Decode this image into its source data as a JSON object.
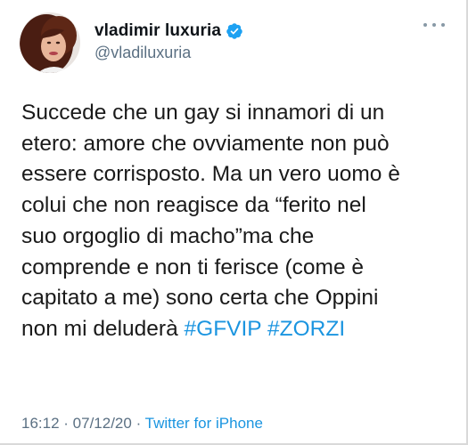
{
  "author": {
    "display_name": "vladimir luxuria",
    "handle": "@vladiluxuria",
    "verified": true,
    "avatar_icon": "profile-photo"
  },
  "tweet": {
    "text": "Succede che un gay si innamori di un\netero: amore che ovviamente non può\nessere corrisposto. Ma un vero uomo è\ncolui che non reagisce da “ferito nel\nsuo orgoglio di macho”ma che\ncomprende e non ti ferisce (come è\ncapitato a me) sono certa che Oppini\nnon mi deluderà ",
    "hashtags": [
      "#GFVIP",
      "#ZORZI"
    ]
  },
  "meta": {
    "time": "16:12",
    "separator1": " · ",
    "date": "07/12/20",
    "separator2": " · ",
    "source": "Twitter for iPhone"
  },
  "colors": {
    "link": "#1b95e0",
    "secondary_text": "#5b7083",
    "verified_badge": "#1da1f2"
  },
  "icons": {
    "verified": "verified-badge-icon",
    "more": "more-options-icon"
  }
}
